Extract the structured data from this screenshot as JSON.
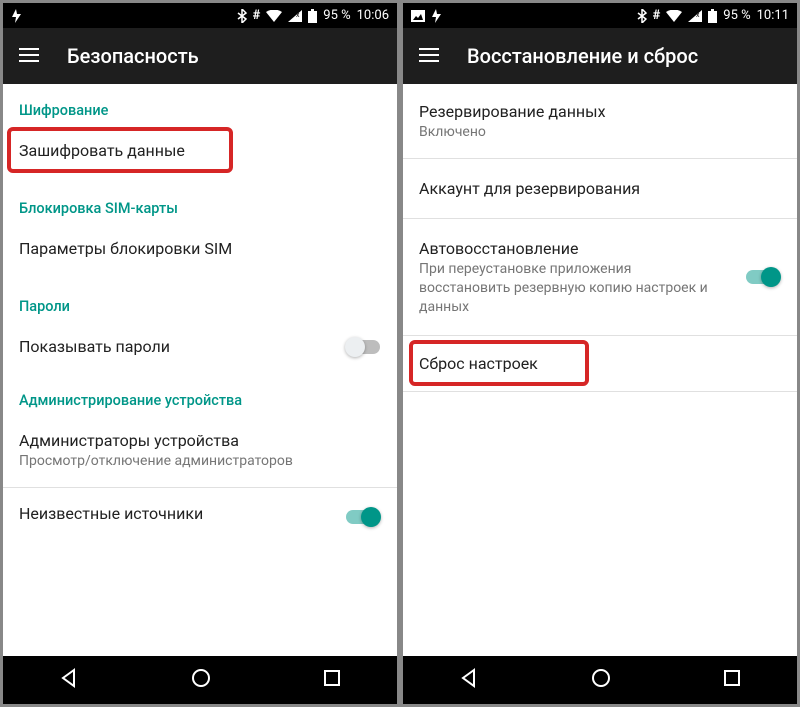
{
  "left": {
    "status": {
      "battery": "95 %",
      "time": "10:06"
    },
    "title": "Безопасность",
    "section_encryption": "Шифрование",
    "encrypt_data": "Зашифровать данные",
    "section_sim": "Блокировка SIM-карты",
    "sim_params": "Параметры блокировки SIM",
    "section_passwords": "Пароли",
    "show_passwords": "Показывать пароли",
    "section_admin": "Администрирование устройства",
    "device_admins": "Администраторы устройства",
    "device_admins_sub": "Просмотр/отключение администраторов",
    "unknown_sources": "Неизвестные источники"
  },
  "right": {
    "status": {
      "battery": "95 %",
      "time": "10:11"
    },
    "title": "Восстановление и сброс",
    "backup_data": "Резервирование данных",
    "backup_data_sub": "Включено",
    "backup_account": "Аккаунт для резервирования",
    "auto_restore": "Автовосстановление",
    "auto_restore_sub": "При переустановке приложения восстановить резервную копию настроек и данных",
    "factory_reset": "Сброс настроек"
  }
}
